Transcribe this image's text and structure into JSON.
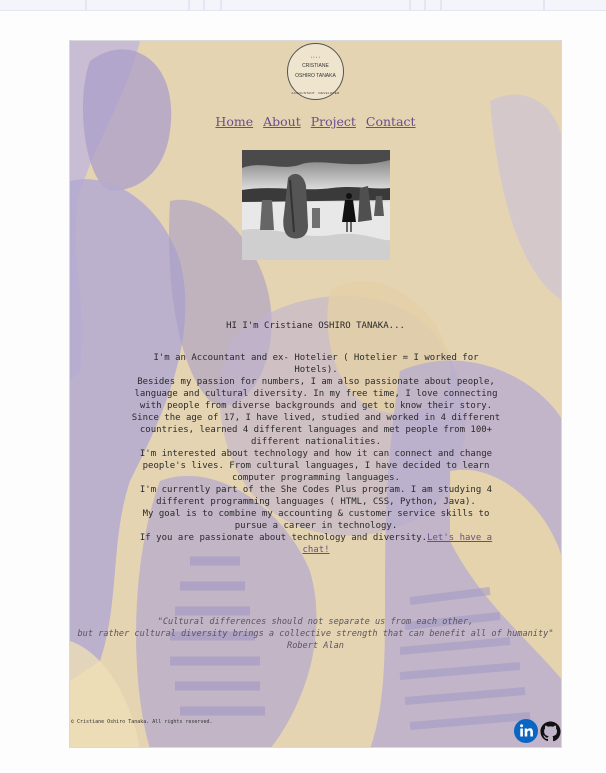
{
  "logo": {
    "top_text": "• • • •",
    "name_line1": "CRISTIANE",
    "name_line2": "OSHIRO TANAKA",
    "bottom_text": "ACCOUNTANT · DEVELOPER"
  },
  "nav": {
    "items": [
      {
        "label": "Home"
      },
      {
        "label": "About"
      },
      {
        "label": "Project"
      },
      {
        "label": "Contact"
      }
    ]
  },
  "greeting": "HI I'm Cristiane OSHIRO TANAKA...",
  "bio": {
    "paragraphs": [
      "I'm an Accountant and ex- Hotelier ( Hotelier = I worked for Hotels).",
      "Besides my passion for numbers, I am also passionate about people, language and cultural diversity. In my free time, I love connecting with people from diverse backgrounds and get to know their story.",
      "Since the age of 17, I have lived, studied and worked in 4 different countries, learned 4 different languages and met people from 100+ different nationalities.",
      "I'm interested about technology and how it can connect and change people's lives. From cultural languages, I have decided to learn computer programming languages.",
      "I'm currently part of the She Codes Plus program. I am studying 4 different programming languages ( HTML, CSS, Python, Java).",
      "My goal is to combine my accounting & customer service skills to pursue a career in technology."
    ],
    "closing": "If you are passionate about technology and diversity.",
    "chat_link": "Let's have a chat!"
  },
  "quote": {
    "line1": "\"Cultural differences should not separate us from each other,",
    "line2": "but rather cultural diversity brings a collective strength that can benefit all of humanity\"",
    "author": "Robert Alan"
  },
  "footer": {
    "copyright": "© Cristiane Oshiro Tanaka. All rights reserved.",
    "linkedin_icon": "linkedin-icon",
    "github_icon": "github-icon"
  },
  "colors": {
    "link": "#6e4b8e",
    "bg_yellow": "#e6d5b2",
    "bg_violet": "#a99fcb",
    "linkedin": "#0a66c2"
  }
}
